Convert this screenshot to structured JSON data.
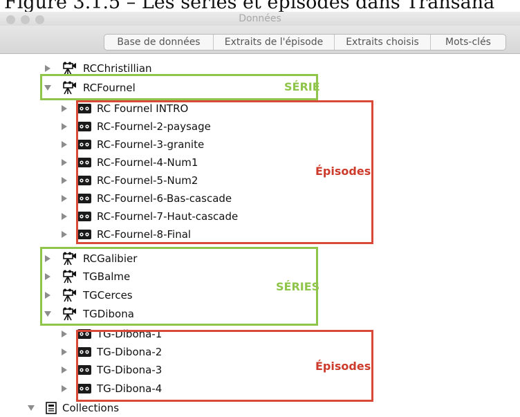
{
  "caption": "Figure 3.1.5 – Les séries et épisodes dans Transana",
  "window": {
    "title": "Données"
  },
  "tabs": [
    "Base de données",
    "Extraits de l'épisode",
    "Extraits choisis",
    "Mots-clés"
  ],
  "tree": {
    "series_top": [
      {
        "label": "RCChristillian",
        "expanded": false
      },
      {
        "label": "RCFournel",
        "expanded": true
      }
    ],
    "episodes_rcfournel": [
      "RC Fournel INTRO",
      "RC-Fournel-2-paysage",
      "RC-Fournel-3-granite",
      "RC-Fournel-4-Num1",
      "RC-Fournel-5-Num2",
      "RC-Fournel-6-Bas-cascade",
      "RC-Fournel-7-Haut-cascade",
      "RC-Fournel-8-Final"
    ],
    "series_mid": [
      {
        "label": "RCGalibier",
        "expanded": false
      },
      {
        "label": "TGBalme",
        "expanded": false
      },
      {
        "label": "TGCerces",
        "expanded": false
      },
      {
        "label": "TGDibona",
        "expanded": true
      }
    ],
    "episodes_tgdibona": [
      "TG-Dibona-1",
      "TG-Dibona-2",
      "TG-Dibona-3",
      "TG-Dibona-4"
    ],
    "collections": {
      "label": "Collections",
      "expanded": true
    }
  },
  "annotations": {
    "serie": "SÉRIE",
    "episodes_1": "Épisodes",
    "series": "SÉRIES",
    "episodes_2": "Épisodes"
  },
  "colors": {
    "green": "#8fc54a",
    "red": "#d84a37"
  },
  "icons": {
    "series": "video-camera-icon",
    "episode": "film-tape-icon",
    "collection": "collection-icon"
  }
}
